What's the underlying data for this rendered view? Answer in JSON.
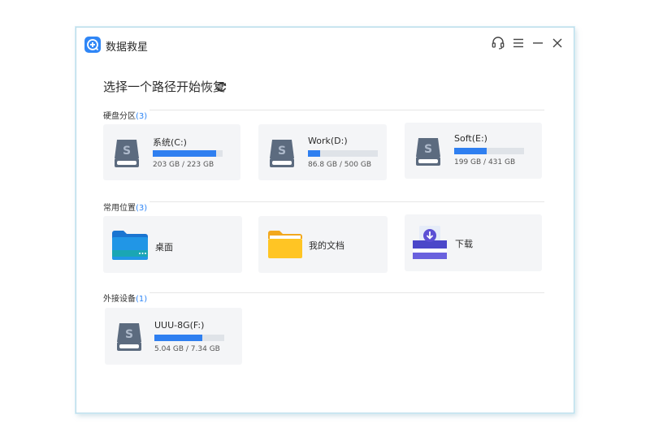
{
  "app": {
    "title": "数据救星"
  },
  "header": {
    "title": "选择一个路径开始恢复"
  },
  "sections": {
    "disks": {
      "title": "硬盘分区",
      "count": "(3)",
      "items": [
        {
          "label": "系统(C:)",
          "size": "203 GB / 223 GB",
          "used": 0.91
        },
        {
          "label": "Work(D:)",
          "size": "86.8 GB / 500 GB",
          "used": 0.17
        },
        {
          "label": "Soft(E:)",
          "size": "199 GB / 431 GB",
          "used": 0.46
        }
      ]
    },
    "locations": {
      "title": "常用位置",
      "count": "(3)",
      "items": [
        {
          "label": "桌面",
          "icon": "desktop-folder-icon"
        },
        {
          "label": "我的文档",
          "icon": "folder-icon"
        },
        {
          "label": "下载",
          "icon": "download-tray-icon"
        }
      ]
    },
    "external": {
      "title": "外接设备",
      "count": "(1)",
      "items": [
        {
          "label": "UUU-8G(F:)",
          "size": "5.04 GB / 7.34 GB",
          "used": 0.69
        }
      ]
    }
  },
  "colors": {
    "accent": "#2f7ff0",
    "card_bg": "#f4f5f7",
    "drive_icon": "#5c6b7f"
  }
}
